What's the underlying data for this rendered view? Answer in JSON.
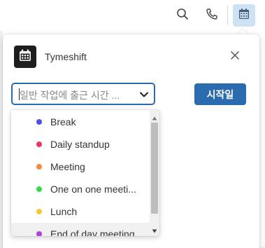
{
  "toolbar": {
    "search_icon": "search-icon",
    "phone_icon": "phone-icon",
    "calendar_icon": "calendar-icon",
    "calendar_active_bg": "#cfe2f3"
  },
  "popup": {
    "app_name": "Tymeshift",
    "select_placeholder": "일반 작업에 출근 시간 ...",
    "start_button": "시작일",
    "accent_color": "#2a6bb0"
  },
  "dropdown": {
    "items": [
      {
        "label": "Break",
        "color": "#4a50e8"
      },
      {
        "label": "Daily standup",
        "color": "#e8365f"
      },
      {
        "label": "Meeting",
        "color": "#f08a3c"
      },
      {
        "label": "One on one meeti...",
        "color": "#3bd94a"
      },
      {
        "label": "Lunch",
        "color": "#f2c833"
      },
      {
        "label": "End of day meeting",
        "color": "#b43ee0"
      }
    ]
  }
}
